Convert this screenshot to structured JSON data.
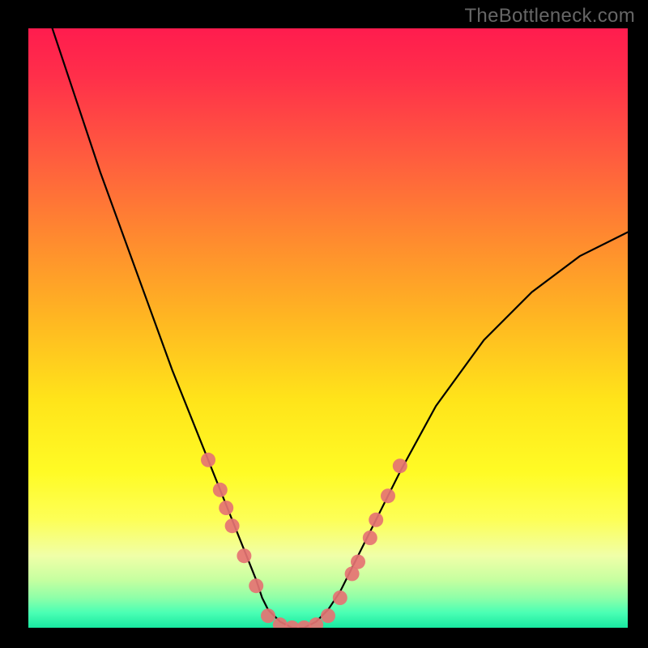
{
  "watermark": "TheBottleneck.com",
  "chart_data": {
    "type": "line",
    "title": "",
    "xlabel": "",
    "ylabel": "",
    "xlim": [
      0,
      100
    ],
    "ylim": [
      0,
      100
    ],
    "series": [
      {
        "name": "bottleneck-curve",
        "x": [
          4,
          8,
          12,
          16,
          20,
          24,
          28,
          30,
          32,
          34,
          36,
          38,
          39,
          40,
          41,
          42,
          44,
          46,
          48,
          50,
          52,
          54,
          58,
          62,
          68,
          76,
          84,
          92,
          100
        ],
        "values": [
          100,
          88,
          76,
          65,
          54,
          43,
          33,
          28,
          23,
          18,
          13,
          8,
          5,
          3,
          2,
          1,
          0,
          0,
          1,
          3,
          6,
          10,
          18,
          26,
          37,
          48,
          56,
          62,
          66
        ]
      }
    ],
    "markers": {
      "name": "highlight-dots",
      "points": [
        {
          "x": 30,
          "y": 28
        },
        {
          "x": 32,
          "y": 23
        },
        {
          "x": 33,
          "y": 20
        },
        {
          "x": 34,
          "y": 17
        },
        {
          "x": 36,
          "y": 12
        },
        {
          "x": 38,
          "y": 7
        },
        {
          "x": 40,
          "y": 2
        },
        {
          "x": 42,
          "y": 0.5
        },
        {
          "x": 44,
          "y": 0
        },
        {
          "x": 46,
          "y": 0
        },
        {
          "x": 48,
          "y": 0.5
        },
        {
          "x": 50,
          "y": 2
        },
        {
          "x": 52,
          "y": 5
        },
        {
          "x": 54,
          "y": 9
        },
        {
          "x": 55,
          "y": 11
        },
        {
          "x": 57,
          "y": 15
        },
        {
          "x": 58,
          "y": 18
        },
        {
          "x": 60,
          "y": 22
        },
        {
          "x": 62,
          "y": 27
        }
      ]
    },
    "background": {
      "type": "vertical-gradient",
      "top_color": "#ff1c4e",
      "bottom_color": "#18e8a0"
    }
  }
}
